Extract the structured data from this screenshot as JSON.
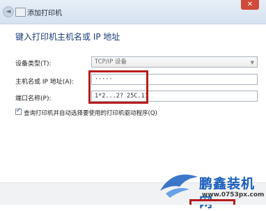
{
  "window": {
    "title": "添加打印机",
    "back_glyph": "◄",
    "close_glyph": "✕"
  },
  "heading": "键入打印机主机名或 IP 地址",
  "form": {
    "device_type_label": "设备类型(T):",
    "device_type_value": "TCP/IP 设备",
    "hostname_label": "主机名或 IP 地址(A):",
    "hostname_value": "·····",
    "port_label": "端口名称(P):",
    "port_value": "1*2...2? 25C.11",
    "auto_driver_label": "查询打印机并自动选择要使用的打印机驱动程序(Q)",
    "auto_driver_checked": true,
    "check_glyph": "✓"
  },
  "watermark": {
    "name": "鹏鑫装机网",
    "url": "www.0753px.com"
  },
  "colors": {
    "highlight": "#b71c1c",
    "heading": "#1a3a78",
    "logo": "#1a5fbf"
  }
}
